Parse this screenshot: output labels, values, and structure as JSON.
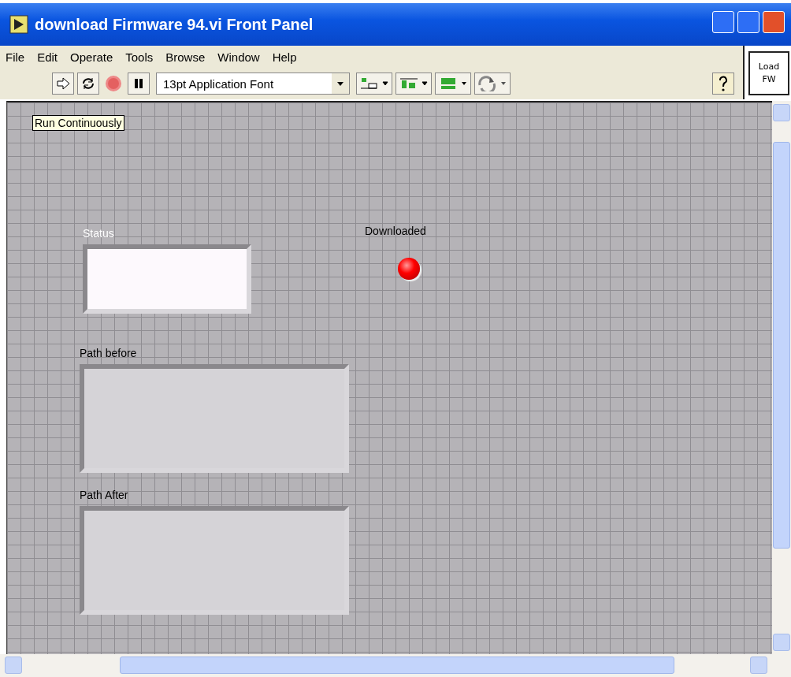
{
  "window": {
    "title": "download Firmware 94.vi Front Panel"
  },
  "menu": [
    "File",
    "Edit",
    "Operate",
    "Tools",
    "Browse",
    "Window",
    "Help"
  ],
  "toolbar": {
    "font": "13pt Application Font"
  },
  "side_button": "Load FW",
  "tooltip": "Run Continuously",
  "controls": [
    {
      "kind": "string",
      "label": "Status"
    },
    {
      "kind": "led",
      "label": "Downloaded",
      "on": true
    },
    {
      "kind": "path",
      "label": "Path before"
    },
    {
      "kind": "path",
      "label": "Path After"
    }
  ]
}
